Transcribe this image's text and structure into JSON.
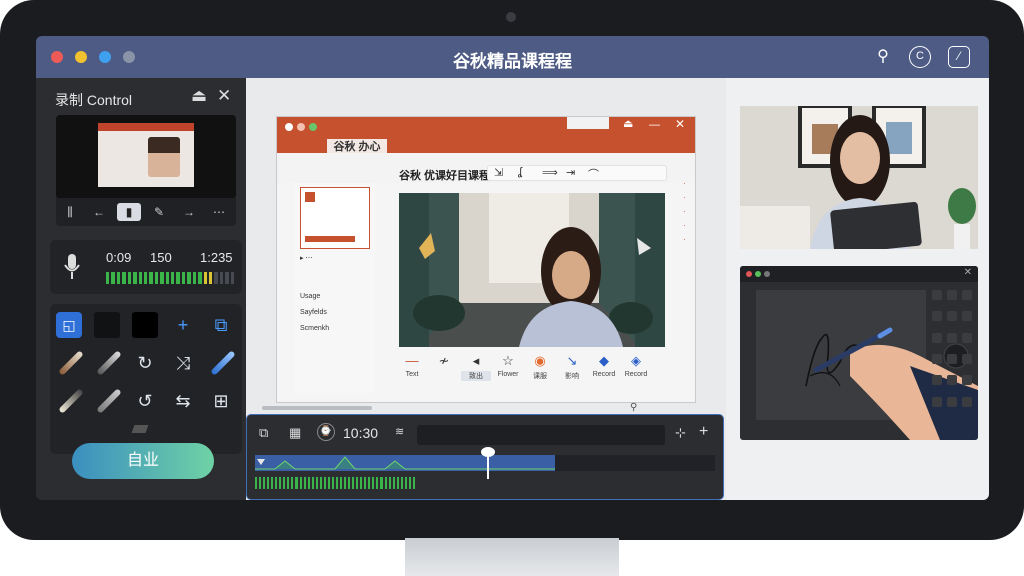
{
  "app": {
    "title": "谷秋精品课程程",
    "window_controls": [
      "close",
      "minimize",
      "maximize",
      "inactive"
    ],
    "toolbar_icons": [
      "search-icon",
      "refresh-icon",
      "crop-icon"
    ]
  },
  "left_panel": {
    "title": "录制 Control",
    "preview_controls": [
      "⫼",
      "←",
      "▮",
      "✎",
      "→",
      "⋯"
    ],
    "audio": {
      "time_elapsed": "0:09",
      "level": "150",
      "time_total": "1:235"
    },
    "primary_button": "自业"
  },
  "document": {
    "tab_label": "谷秋 办心",
    "heading": "谷秋 优课好目课程",
    "sidebar_items": [
      "Usage",
      "Sayfelds",
      "Scmenkh"
    ],
    "toolbar": [
      {
        "icon": "—",
        "label": "Text"
      },
      {
        "icon": "≁",
        "label": ""
      },
      {
        "icon": "◂",
        "label": "致出"
      },
      {
        "icon": "☆",
        "label": "Flower"
      },
      {
        "icon": "◉",
        "label": "课服"
      },
      {
        "icon": "↘",
        "label": "影响"
      },
      {
        "icon": "◆",
        "label": "Record"
      },
      {
        "icon": "◈",
        "label": "Record"
      }
    ]
  },
  "timeline": {
    "time": "10:30",
    "playhead_position_fraction": 0.8
  },
  "colors": {
    "titlebar": "#4d5b85",
    "accent_blue": "#2f6fd8",
    "record_red": "#c5512f",
    "meter_green": "#3bb54a"
  }
}
